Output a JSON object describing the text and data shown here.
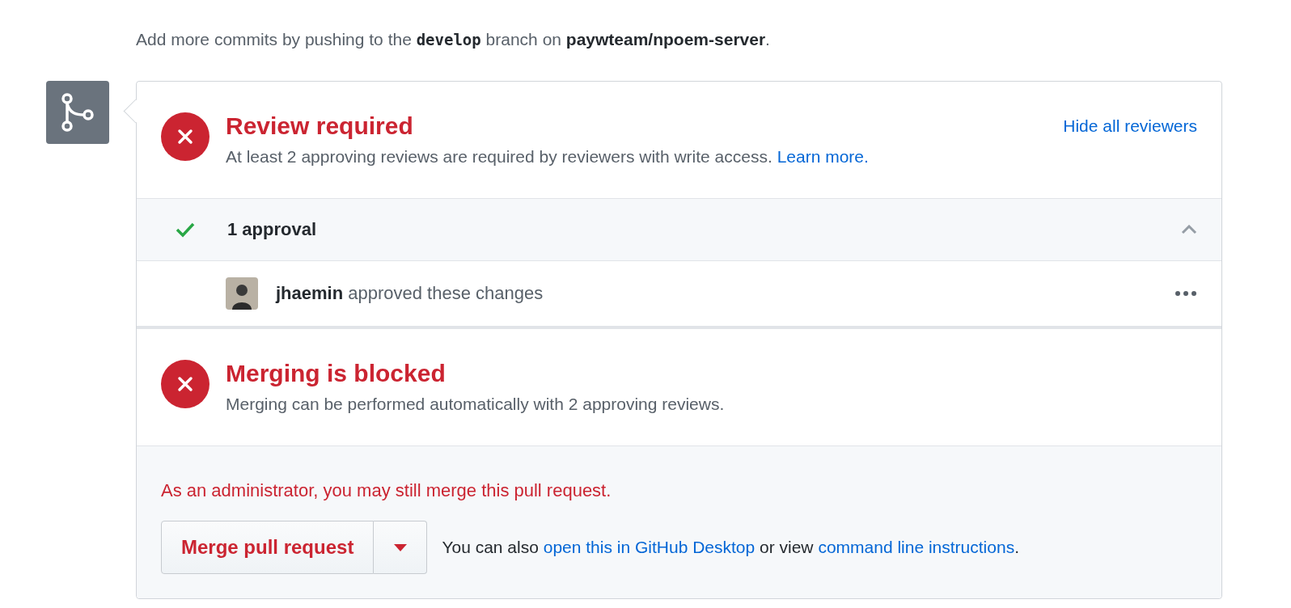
{
  "intro": [
    {
      "kind": "text",
      "text": "Add more commits by pushing to the "
    },
    {
      "kind": "code",
      "text": "develop"
    },
    {
      "kind": "text",
      "text": " branch on "
    },
    {
      "kind": "strong",
      "text": "paywteam/npoem-server"
    },
    {
      "kind": "text",
      "text": "."
    }
  ],
  "review": {
    "title": "Review required",
    "description": "At least 2 approving reviews are required by reviewers with write access.",
    "link": "Learn more.",
    "toggle_link": "Hide all reviewers"
  },
  "approvals": {
    "label": "1 approval",
    "expanded": true,
    "reviewers": [
      {
        "name": "jhaemin",
        "action": "approved these changes"
      }
    ]
  },
  "merge_status": {
    "title": "Merging is blocked",
    "description": "Merging can be performed automatically with 2 approving reviews."
  },
  "admin": {
    "notice": "As an administrator, you may still merge this pull request.",
    "merge_button": "Merge pull request",
    "help": [
      {
        "kind": "text",
        "text": "You can also "
      },
      {
        "kind": "link",
        "text": "open this in GitHub Desktop"
      },
      {
        "kind": "text",
        "text": " or view "
      },
      {
        "kind": "link",
        "text": "command line instructions"
      },
      {
        "kind": "text",
        "text": "."
      }
    ]
  }
}
